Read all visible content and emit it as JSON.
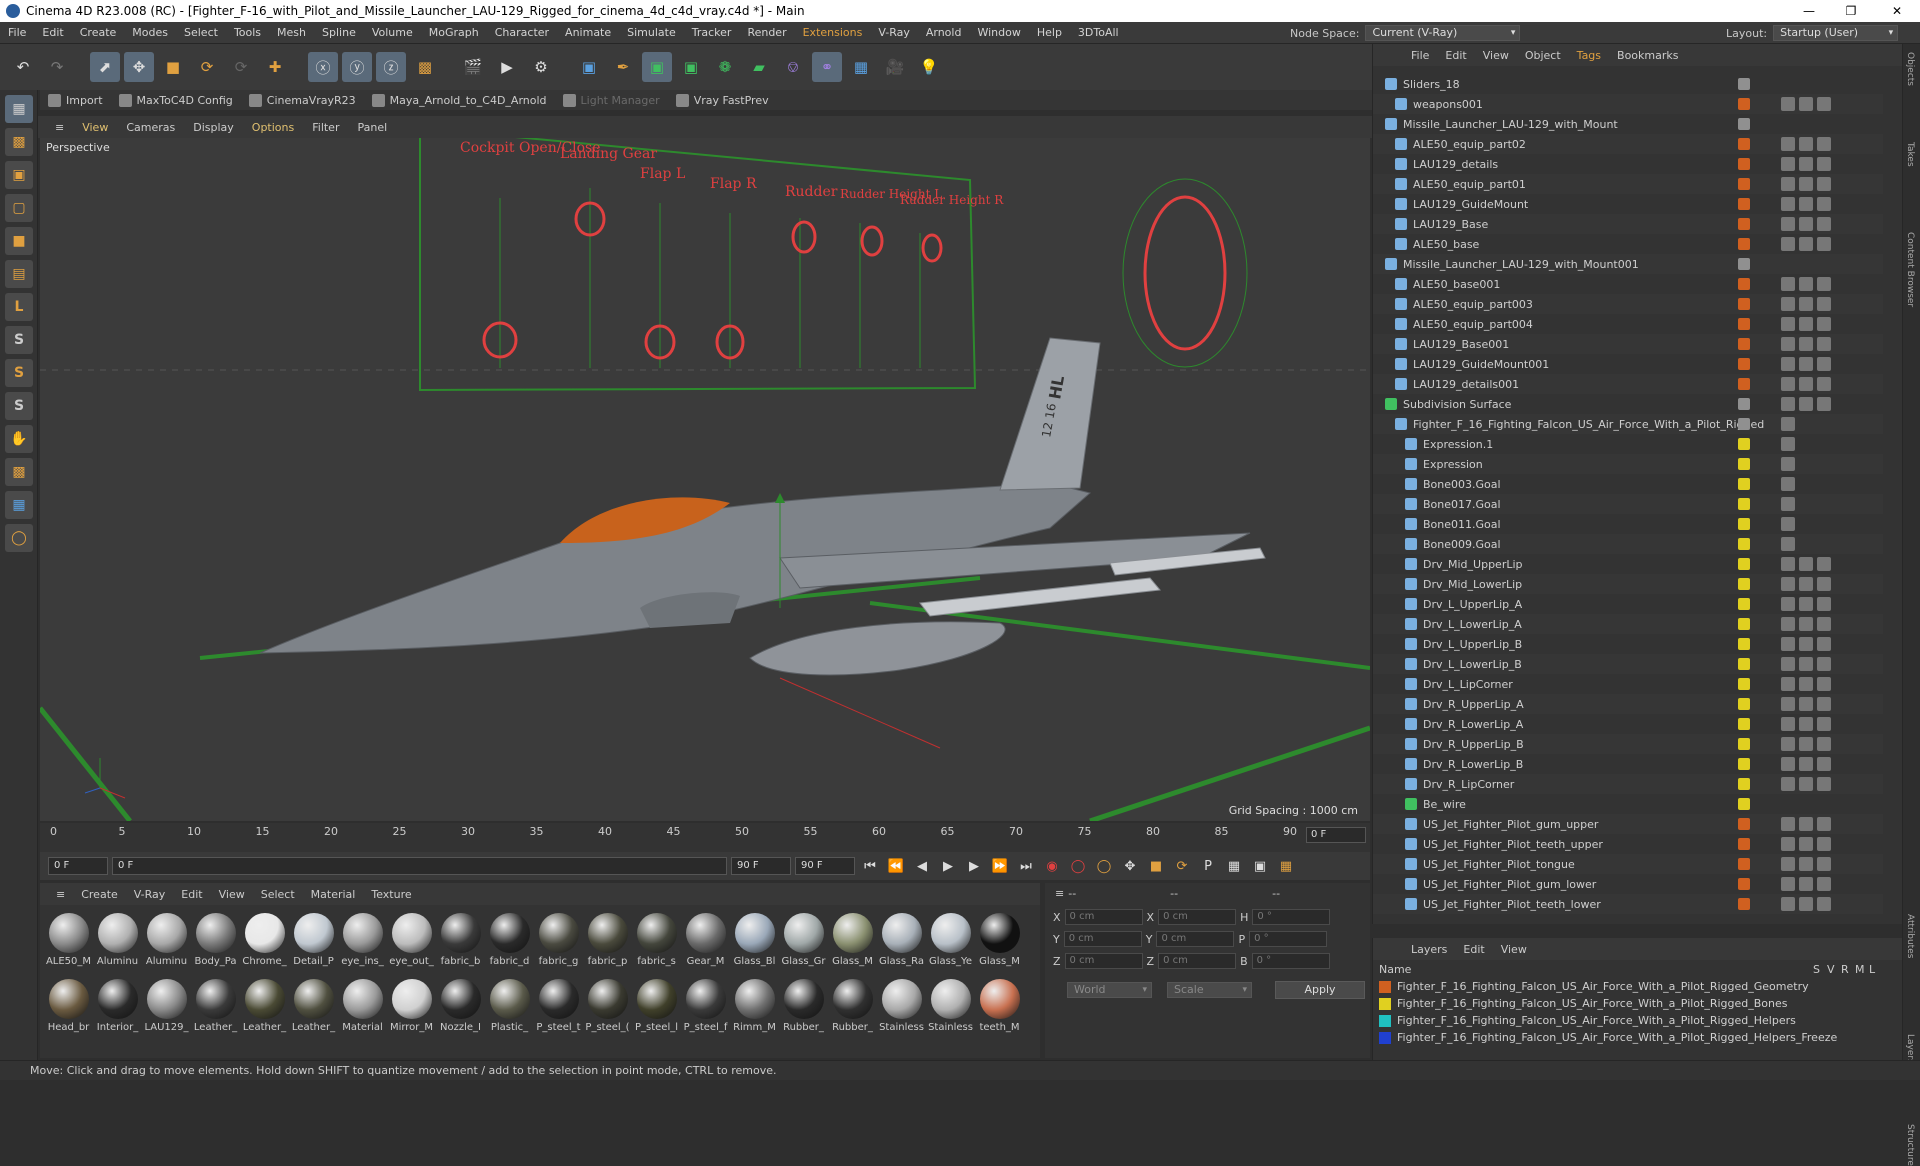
{
  "window": {
    "title": "Cinema 4D R23.008 (RC) - [Fighter_F-16_with_Pilot_and_Missile_Launcher_LAU-129_Rigged_for_cinema_4d_c4d_vray.c4d *] - Main"
  },
  "menu": [
    "File",
    "Edit",
    "Create",
    "Modes",
    "Select",
    "Tools",
    "Mesh",
    "Spline",
    "Volume",
    "MoGraph",
    "Character",
    "Animate",
    "Simulate",
    "Tracker",
    "Render",
    "Extensions",
    "V-Ray",
    "Arnold",
    "Window",
    "Help",
    "3DToAll"
  ],
  "node_space": {
    "label": "Node Space:",
    "value": "Current (V-Ray)"
  },
  "layout": {
    "label": "Layout:",
    "value": "Startup (User)"
  },
  "plugins": [
    {
      "label": "Import",
      "dim": false
    },
    {
      "label": "MaxToC4D Config",
      "dim": false
    },
    {
      "label": "CinemaVrayR23",
      "dim": false
    },
    {
      "label": "Maya_Arnold_to_C4D_Arnold",
      "dim": false
    },
    {
      "label": "Light Manager",
      "dim": true
    },
    {
      "label": "Vray FastPrev",
      "dim": false
    }
  ],
  "viewport_menu": [
    "View",
    "Cameras",
    "Display",
    "Options",
    "Filter",
    "Panel"
  ],
  "viewport": {
    "label": "Perspective",
    "grid_spacing": "Grid Spacing : 1000 cm",
    "hud": [
      "Cockpit Open/Close",
      "Landing Gear",
      "Flap L",
      "Flap R",
      "Rudder",
      "Rudder Height L",
      "Rudder Height R"
    ],
    "tail_code": "HL",
    "tail_number": "12 16",
    "accent_color": "#e04040"
  },
  "timeline": {
    "ticks": [
      "0",
      "5",
      "10",
      "15",
      "20",
      "25",
      "30",
      "35",
      "40",
      "45",
      "50",
      "55",
      "60",
      "65",
      "70",
      "75",
      "80",
      "85",
      "90"
    ],
    "current_frame": "0 F"
  },
  "transport": {
    "start": "0 F",
    "current": "0 F",
    "end": "90 F",
    "max": "90 F"
  },
  "material_menu": [
    "Create",
    "V-Ray",
    "Edit",
    "View",
    "Select",
    "Material",
    "Texture"
  ],
  "materials": [
    {
      "name": "ALE50_M",
      "color": "#8a8a8a"
    },
    {
      "name": "Aluminu",
      "color": "#b0b0b0"
    },
    {
      "name": "Aluminu",
      "color": "#a8a8a8"
    },
    {
      "name": "Body_Pa",
      "color": "#7a7a7a"
    },
    {
      "name": "Chrome_",
      "color": "#e8e8e8"
    },
    {
      "name": "Detail_P",
      "color": "#c0c8d0"
    },
    {
      "name": "eye_ins_",
      "color": "#9a9a9a"
    },
    {
      "name": "eye_out_",
      "color": "#bcbcbc"
    },
    {
      "name": "fabric_b",
      "color": "#3a3a3a"
    },
    {
      "name": "fabric_d",
      "color": "#2a2a2a"
    },
    {
      "name": "fabric_g",
      "color": "#4a4a40"
    },
    {
      "name": "fabric_p",
      "color": "#4a4a3c"
    },
    {
      "name": "fabric_s",
      "color": "#44463c"
    },
    {
      "name": "Gear_M",
      "color": "#6a6a6a"
    },
    {
      "name": "Glass_Bl",
      "color": "#9aa8b8"
    },
    {
      "name": "Glass_Gr",
      "color": "#a0a8a8"
    },
    {
      "name": "Glass_M",
      "color": "#8a9070"
    },
    {
      "name": "Glass_Ra",
      "color": "#a8b0b8"
    },
    {
      "name": "Glass_Ye",
      "color": "#b8c0c8"
    },
    {
      "name": "Glass_M",
      "color": "#111111"
    },
    {
      "name": "Head_br",
      "color": "#6a5a40"
    },
    {
      "name": "Interior_",
      "color": "#2a2a2a"
    },
    {
      "name": "LAU129_",
      "color": "#8a8a8a"
    },
    {
      "name": "Leather_",
      "color": "#3a3a3a"
    },
    {
      "name": "Leather_",
      "color": "#4a4a34"
    },
    {
      "name": "Leather_",
      "color": "#505040"
    },
    {
      "name": "Material",
      "color": "#9a9a9a"
    },
    {
      "name": "Mirror_M",
      "color": "#d0d0d0"
    },
    {
      "name": "Nozzle_I",
      "color": "#2a2a2a"
    },
    {
      "name": "Plastic_",
      "color": "#5a5a4a"
    },
    {
      "name": "P_steel_t",
      "color": "#2a2a2a"
    },
    {
      "name": "P_steel_(",
      "color": "#3a3a30"
    },
    {
      "name": "P_steel_l",
      "color": "#40402a"
    },
    {
      "name": "P_steel_f",
      "color": "#3a3a3a"
    },
    {
      "name": "Rimm_M",
      "color": "#707070"
    },
    {
      "name": "Rubber_",
      "color": "#2a2a2a"
    },
    {
      "name": "Rubber_",
      "color": "#303030"
    },
    {
      "name": "Stainless",
      "color": "#a8a8a8"
    },
    {
      "name": "Stainless",
      "color": "#b0b0b0"
    },
    {
      "name": "teeth_M",
      "color": "#c87050"
    }
  ],
  "attributes": {
    "rows": [
      {
        "a": "X",
        "av": "0 cm",
        "b": "X",
        "bv": "0 cm",
        "c": "H",
        "cv": "0 °"
      },
      {
        "a": "Y",
        "av": "0 cm",
        "b": "Y",
        "bv": "0 cm",
        "c": "P",
        "cv": "0 °"
      },
      {
        "a": "Z",
        "av": "0 cm",
        "b": "Z",
        "bv": "0 cm",
        "c": "B",
        "cv": "0 °"
      }
    ],
    "coord": "World",
    "mode": "Scale",
    "apply": "Apply",
    "dashes": "--"
  },
  "object_menu": [
    {
      "label": "File",
      "hl": false
    },
    {
      "label": "Edit",
      "hl": false
    },
    {
      "label": "View",
      "hl": false
    },
    {
      "label": "Object",
      "hl": false
    },
    {
      "label": "Tags",
      "hl": true
    },
    {
      "label": "Bookmarks",
      "hl": false
    }
  ],
  "objects": [
    {
      "name": "Sliders_18",
      "indent": 0,
      "color": "#909090",
      "type": "null"
    },
    {
      "name": "weapons001",
      "indent": 1,
      "color": "#d06020",
      "type": "mesh"
    },
    {
      "name": "Missile_Launcher_LAU-129_with_Mount",
      "indent": 0,
      "color": "#909090",
      "type": "null"
    },
    {
      "name": "ALE50_equip_part02",
      "indent": 1,
      "color": "#d06020",
      "type": "mesh"
    },
    {
      "name": "LAU129_details",
      "indent": 1,
      "color": "#d06020",
      "type": "mesh"
    },
    {
      "name": "ALE50_equip_part01",
      "indent": 1,
      "color": "#d06020",
      "type": "mesh"
    },
    {
      "name": "LAU129_GuideMount",
      "indent": 1,
      "color": "#d06020",
      "type": "mesh"
    },
    {
      "name": "LAU129_Base",
      "indent": 1,
      "color": "#d06020",
      "type": "mesh"
    },
    {
      "name": "ALE50_base",
      "indent": 1,
      "color": "#d06020",
      "type": "mesh"
    },
    {
      "name": "Missile_Launcher_LAU-129_with_Mount001",
      "indent": 0,
      "color": "#909090",
      "type": "null"
    },
    {
      "name": "ALE50_base001",
      "indent": 1,
      "color": "#d06020",
      "type": "mesh"
    },
    {
      "name": "ALE50_equip_part003",
      "indent": 1,
      "color": "#d06020",
      "type": "mesh"
    },
    {
      "name": "ALE50_equip_part004",
      "indent": 1,
      "color": "#d06020",
      "type": "mesh"
    },
    {
      "name": "LAU129_Base001",
      "indent": 1,
      "color": "#d06020",
      "type": "mesh"
    },
    {
      "name": "LAU129_GuideMount001",
      "indent": 1,
      "color": "#d06020",
      "type": "mesh"
    },
    {
      "name": "LAU129_details001",
      "indent": 1,
      "color": "#d06020",
      "type": "mesh"
    },
    {
      "name": "Subdivision Surface",
      "indent": 0,
      "color": "#909090",
      "type": "sub"
    },
    {
      "name": "Fighter_F_16_Fighting_Falcon_US_Air_Force_With_a_Pilot_Rigged",
      "indent": 1,
      "color": "#909090",
      "type": "null"
    },
    {
      "name": "Expression.1",
      "indent": 2,
      "color": "#e0d020",
      "type": "null"
    },
    {
      "name": "Expression",
      "indent": 2,
      "color": "#e0d020",
      "type": "null"
    },
    {
      "name": "Bone003.Goal",
      "indent": 2,
      "color": "#e0d020",
      "type": "null"
    },
    {
      "name": "Bone017.Goal",
      "indent": 2,
      "color": "#e0d020",
      "type": "null"
    },
    {
      "name": "Bone011.Goal",
      "indent": 2,
      "color": "#e0d020",
      "type": "null"
    },
    {
      "name": "Bone009.Goal",
      "indent": 2,
      "color": "#e0d020",
      "type": "null"
    },
    {
      "name": "Drv_Mid_UpperLip",
      "indent": 2,
      "color": "#e0d020",
      "type": "joint"
    },
    {
      "name": "Drv_Mid_LowerLip",
      "indent": 2,
      "color": "#e0d020",
      "type": "joint"
    },
    {
      "name": "Drv_L_UpperLip_A",
      "indent": 2,
      "color": "#e0d020",
      "type": "joint"
    },
    {
      "name": "Drv_L_LowerLip_A",
      "indent": 2,
      "color": "#e0d020",
      "type": "joint"
    },
    {
      "name": "Drv_L_UpperLip_B",
      "indent": 2,
      "color": "#e0d020",
      "type": "joint"
    },
    {
      "name": "Drv_L_LowerLip_B",
      "indent": 2,
      "color": "#e0d020",
      "type": "joint"
    },
    {
      "name": "Drv_L_LipCorner",
      "indent": 2,
      "color": "#e0d020",
      "type": "joint"
    },
    {
      "name": "Drv_R_UpperLip_A",
      "indent": 2,
      "color": "#e0d020",
      "type": "joint"
    },
    {
      "name": "Drv_R_LowerLip_A",
      "indent": 2,
      "color": "#e0d020",
      "type": "joint"
    },
    {
      "name": "Drv_R_UpperLip_B",
      "indent": 2,
      "color": "#e0d020",
      "type": "joint"
    },
    {
      "name": "Drv_R_LowerLip_B",
      "indent": 2,
      "color": "#e0d020",
      "type": "joint"
    },
    {
      "name": "Drv_R_LipCorner",
      "indent": 2,
      "color": "#e0d020",
      "type": "joint"
    },
    {
      "name": "Be_wire",
      "indent": 2,
      "color": "#e0d020",
      "type": "spline"
    },
    {
      "name": "US_Jet_Fighter_Pilot_gum_upper",
      "indent": 2,
      "color": "#d06020",
      "type": "mesh"
    },
    {
      "name": "US_Jet_Fighter_Pilot_teeth_upper",
      "indent": 2,
      "color": "#d06020",
      "type": "mesh"
    },
    {
      "name": "US_Jet_Fighter_Pilot_tongue",
      "indent": 2,
      "color": "#d06020",
      "type": "mesh"
    },
    {
      "name": "US_Jet_Fighter_Pilot_gum_lower",
      "indent": 2,
      "color": "#d06020",
      "type": "mesh"
    },
    {
      "name": "US_Jet_Fighter_Pilot_teeth_lower",
      "indent": 2,
      "color": "#d06020",
      "type": "mesh"
    }
  ],
  "layers_menu": [
    "Layers",
    "Edit",
    "View"
  ],
  "layers_header": {
    "name": "Name",
    "cols": [
      "S",
      "V",
      "R",
      "M",
      "L"
    ]
  },
  "layers": [
    {
      "name": "Fighter_F_16_Fighting_Falcon_US_Air_Force_With_a_Pilot_Rigged_Geometry",
      "color": "#d06020"
    },
    {
      "name": "Fighter_F_16_Fighting_Falcon_US_Air_Force_With_a_Pilot_Rigged_Bones",
      "color": "#e0d020"
    },
    {
      "name": "Fighter_F_16_Fighting_Falcon_US_Air_Force_With_a_Pilot_Rigged_Helpers",
      "color": "#20c0c0"
    },
    {
      "name": "Fighter_F_16_Fighting_Falcon_US_Air_Force_With_a_Pilot_Rigged_Helpers_Freeze",
      "color": "#2040d0"
    }
  ],
  "right_tabs": [
    "Objects",
    "Takes",
    "Content Browser",
    "Attributes",
    "Layers",
    "Structure"
  ],
  "status": "Move: Click and drag to move elements. Hold down SHIFT to quantize movement / add to the selection in point mode, CTRL to remove."
}
